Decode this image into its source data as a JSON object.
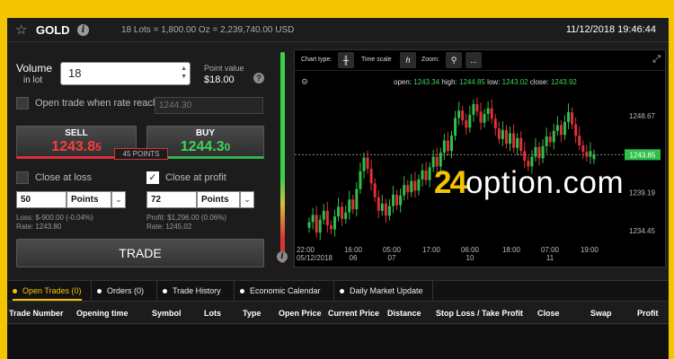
{
  "header": {
    "asset": "GOLD",
    "summary": "18 Lots = 1,800.00 Oz = 2,239,740.00 USD",
    "datetime": "11/12/2018 19:46:44"
  },
  "volume": {
    "label": "Volume",
    "sublabel": "in lot",
    "value": "18",
    "point_value_label": "Point value",
    "point_value": "$18.00"
  },
  "open_rate": {
    "label": "Open trade when rate reach",
    "placeholder": "1244.30",
    "checked": false
  },
  "sell": {
    "label": "SELL",
    "price_main": "1243.8",
    "price_tail": "5"
  },
  "buy": {
    "label": "BUY",
    "price_main": "1244.3",
    "price_tail": "0"
  },
  "spread": "45 POINTS",
  "close_loss": {
    "label": "Close at loss",
    "value": "50",
    "unit": "Points",
    "info_line1": "Loss: $-900.00 (-0.04%)",
    "info_line2": "Rate: 1243.80"
  },
  "close_profit": {
    "label": "Close at profit",
    "value": "72",
    "unit": "Points",
    "info_line1": "Profit: $1,296.00 (0.06%)",
    "info_line2": "Rate: 1245.02"
  },
  "trade_button": "TRADE",
  "chart": {
    "chart_type_label": "Chart type:",
    "time_scale_label": "Time scale",
    "time_scale_value": "h",
    "zoom_label": "Zoom:",
    "more": "...",
    "ohlc": {
      "open_label": "open:",
      "open": "1243.34",
      "high_label": "high:",
      "high": "1244.85",
      "low_label": "low:",
      "low": "1243.02",
      "close_label": "close:",
      "close": "1243.92"
    },
    "logo_num": "24",
    "logo_text": "option.com",
    "current_price": "1243.85",
    "colors": {
      "up": "#2fbf4a",
      "down": "#e0303a",
      "price_tag": "#2fbf4a"
    }
  },
  "chart_data": {
    "type": "candlestick",
    "y_ticks": [
      "1248.67",
      "1239.19",
      "1234.45"
    ],
    "current_price": 1243.85,
    "ylim": [
      1232,
      1252
    ],
    "x_ticks": [
      {
        "time": "22:00",
        "date": "05/12/2018"
      },
      {
        "time": "16:00",
        "date": "06"
      },
      {
        "time": "05:00",
        "date": "07"
      },
      {
        "time": "17:00",
        "date": ""
      },
      {
        "time": "06:00",
        "date": "10"
      },
      {
        "time": "18:00",
        "date": ""
      },
      {
        "time": "07:00",
        "date": "11"
      },
      {
        "time": "19:00",
        "date": ""
      }
    ],
    "closes": [
      1235.5,
      1236.4,
      1234.2,
      1235.8,
      1236.9,
      1235.1,
      1234.6,
      1236.2,
      1237.4,
      1235.9,
      1236.7,
      1238.3,
      1237.1,
      1239.6,
      1241.8,
      1243.5,
      1242.1,
      1240.3,
      1238.6,
      1236.9,
      1237.8,
      1236.3,
      1237.5,
      1238.9,
      1237.6,
      1238.8,
      1240.1,
      1239.2,
      1240.6,
      1239.4,
      1240.8,
      1241.9,
      1240.7,
      1242.3,
      1243.6,
      1242.4,
      1244.1,
      1245.6,
      1244.3,
      1246.2,
      1248.4,
      1249.3,
      1248.1,
      1247.2,
      1248.8,
      1250.1,
      1249.2,
      1247.8,
      1248.9,
      1249.6,
      1248.3,
      1247.1,
      1245.8,
      1246.9,
      1245.2,
      1246.5,
      1244.7,
      1245.9,
      1244.3,
      1243.1,
      1242.4,
      1243.6,
      1244.8,
      1243.4,
      1244.9,
      1246.1,
      1245.4,
      1246.8,
      1247.5,
      1246.3,
      1247.9,
      1249.1,
      1247.6,
      1246.2,
      1245.0,
      1244.2,
      1243.6,
      1244.3,
      1243.9
    ],
    "opens": [
      1234.8,
      1235.5,
      1236.4,
      1234.2,
      1235.8,
      1236.9,
      1235.1,
      1234.6,
      1236.2,
      1237.4,
      1235.9,
      1236.7,
      1238.3,
      1237.1,
      1239.6,
      1241.8,
      1243.5,
      1242.1,
      1240.3,
      1238.6,
      1236.9,
      1237.8,
      1236.3,
      1237.5,
      1238.9,
      1237.6,
      1238.8,
      1240.1,
      1239.2,
      1240.6,
      1239.4,
      1240.8,
      1241.9,
      1240.7,
      1242.3,
      1243.6,
      1242.4,
      1244.1,
      1245.6,
      1244.3,
      1246.2,
      1248.4,
      1249.3,
      1248.1,
      1247.2,
      1248.8,
      1250.1,
      1249.2,
      1247.8,
      1248.9,
      1249.6,
      1248.3,
      1247.1,
      1245.8,
      1246.9,
      1245.2,
      1246.5,
      1244.7,
      1245.9,
      1244.3,
      1243.1,
      1242.4,
      1243.6,
      1244.8,
      1243.4,
      1244.9,
      1246.1,
      1245.4,
      1246.8,
      1247.5,
      1246.3,
      1247.9,
      1249.1,
      1247.6,
      1246.2,
      1245.0,
      1244.2,
      1243.6,
      1243.3
    ]
  },
  "tabs": [
    {
      "label": "Open Trades (0)",
      "active": true
    },
    {
      "label": "Orders (0)",
      "active": false
    },
    {
      "label": "Trade History",
      "active": false
    },
    {
      "label": "Economic Calendar",
      "active": false
    },
    {
      "label": "Daily Market Update",
      "active": false
    }
  ],
  "columns": [
    "Trade Number",
    "Opening time",
    "Symbol",
    "Lots",
    "Type",
    "Open Price",
    "Current Price",
    "Distance",
    "Stop Loss / Take Profit",
    "Close",
    "Swap",
    "Profit"
  ]
}
